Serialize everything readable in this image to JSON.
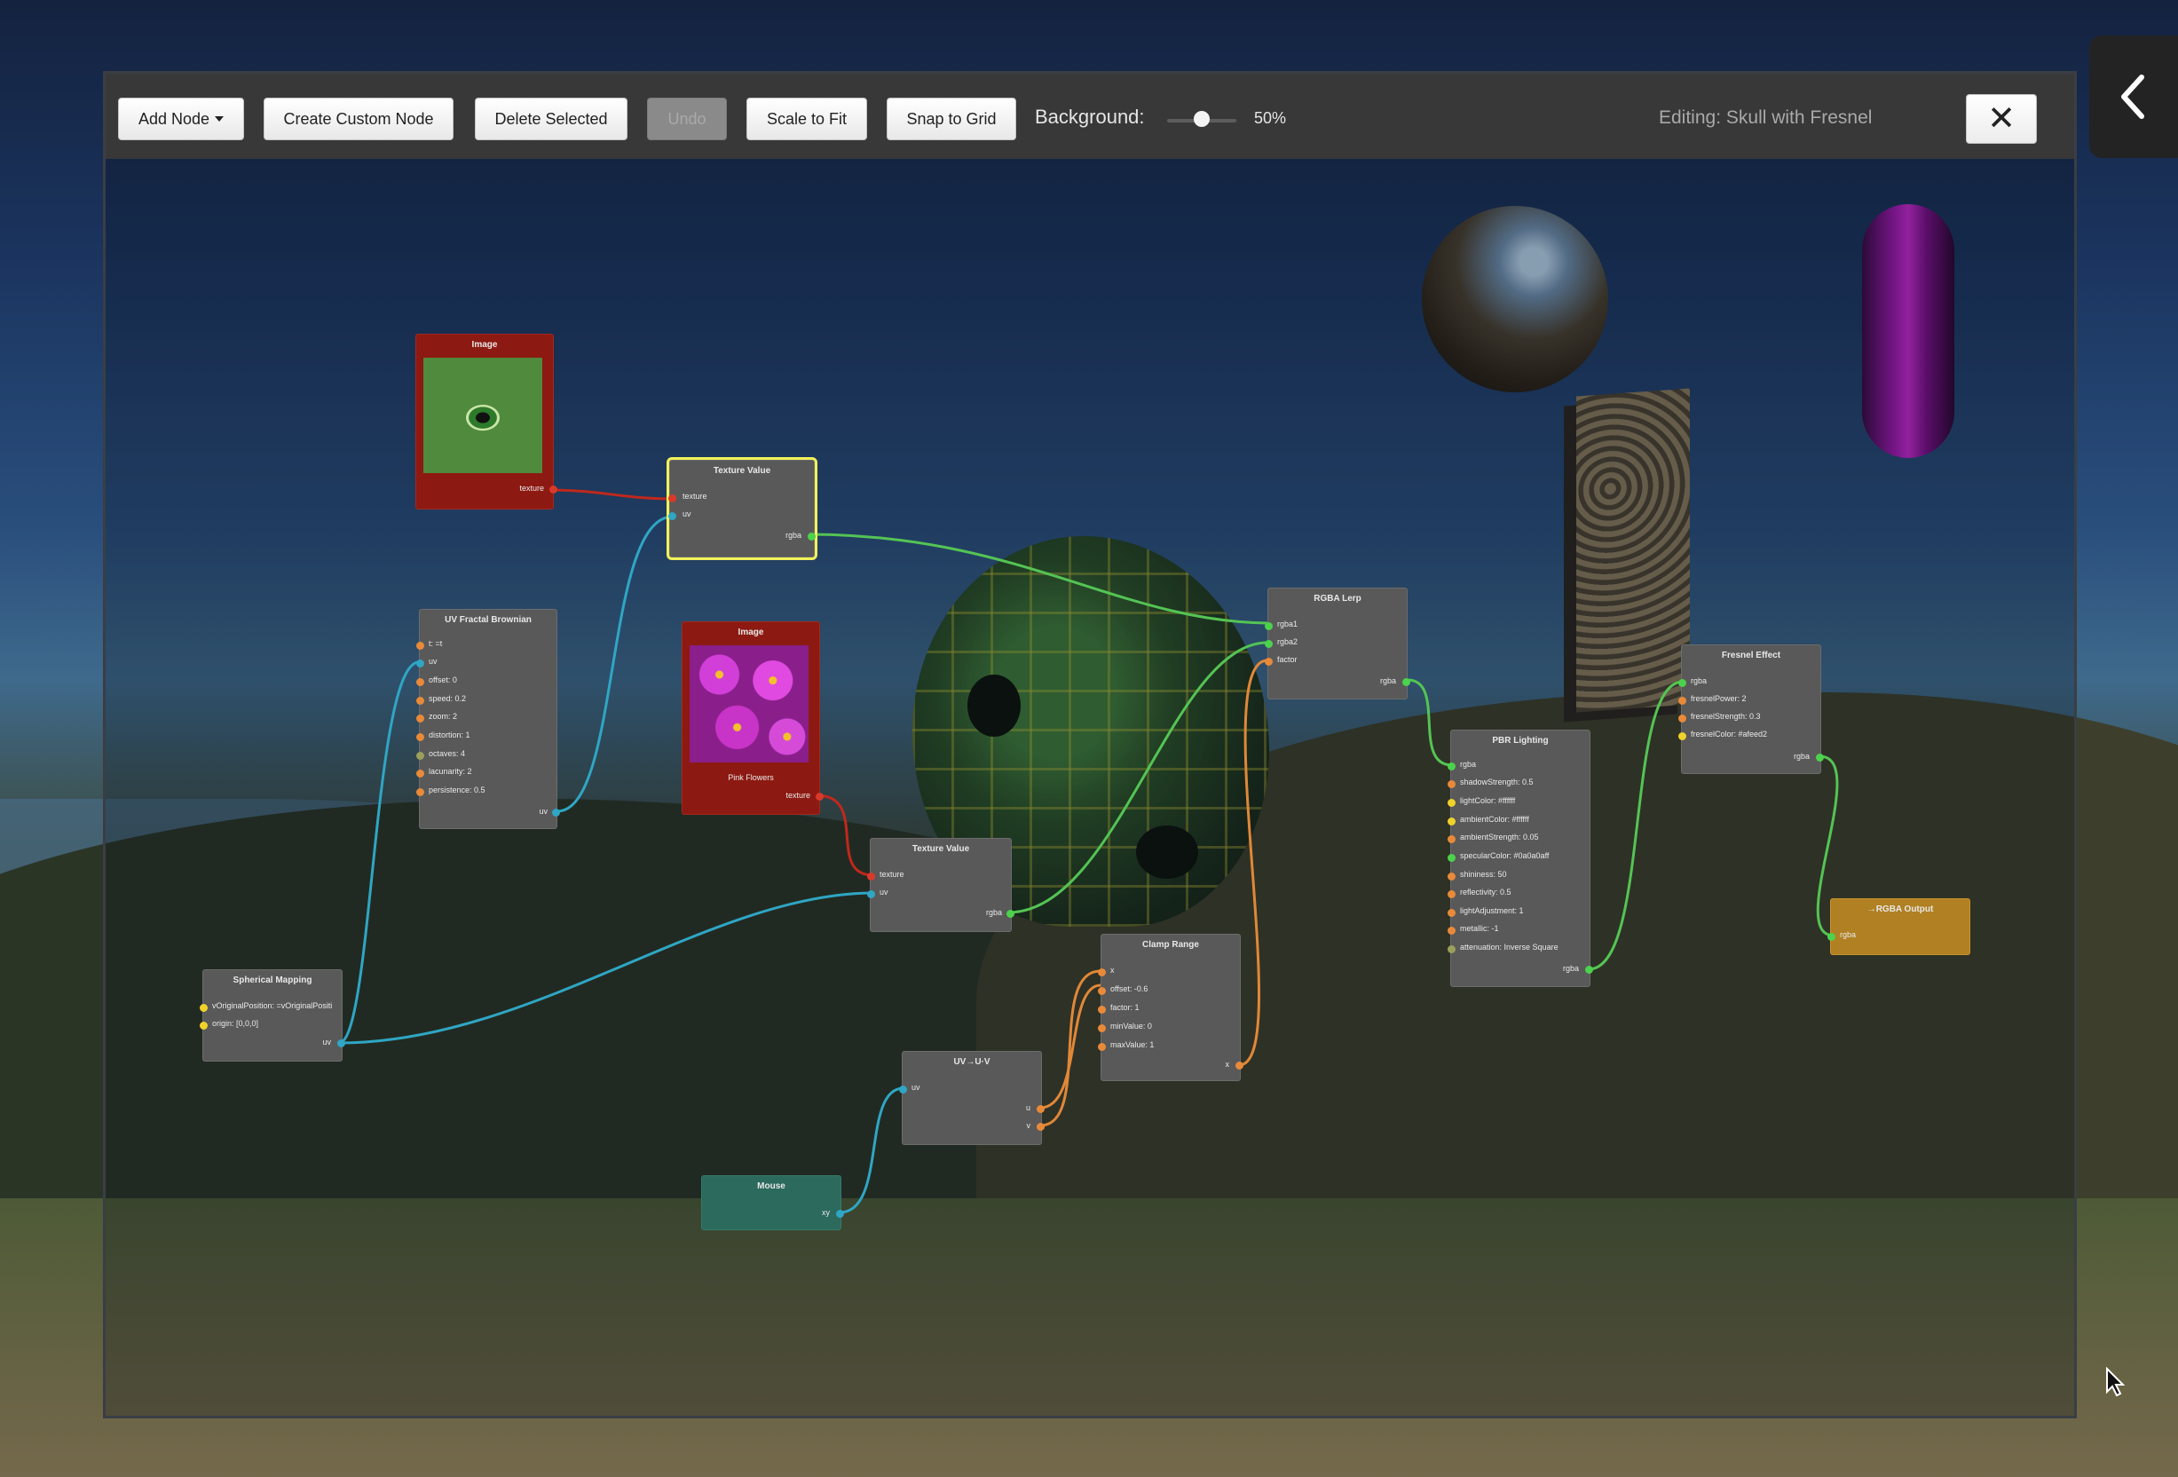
{
  "toolbar": {
    "add_node": "Add Node",
    "create_custom_node": "Create Custom Node",
    "delete_selected": "Delete Selected",
    "undo": "Undo",
    "scale_to_fit": "Scale to Fit",
    "snap_to_grid": "Snap to Grid",
    "background_label": "Background:",
    "background_value": "50%",
    "background_level": 0.5,
    "editing_label": "Editing: Skull with Fresnel",
    "close": "✕"
  },
  "nodes": {
    "image_eye": {
      "title": "Image",
      "out_texture": "texture"
    },
    "texture_value_1": {
      "title": "Texture Value",
      "in_texture": "texture",
      "in_uv": "uv",
      "out_rgba": "rgba"
    },
    "uv_fractal": {
      "title": "UV Fractal Brownian",
      "inputs": [
        "t: =t",
        "uv",
        "offset: 0",
        "speed: 0.2",
        "zoom: 2",
        "distortion: 1",
        "octaves: 4",
        "lacunarity: 2",
        "persistence: 0.5"
      ],
      "out_uv": "uv"
    },
    "image_flowers": {
      "title": "Image",
      "caption": "Pink Flowers",
      "out_texture": "texture"
    },
    "texture_value_2": {
      "title": "Texture Value",
      "in_texture": "texture",
      "in_uv": "uv",
      "out_rgba": "rgba"
    },
    "rgba_lerp": {
      "title": "RGBA Lerp",
      "inputs": [
        "rgba1",
        "rgba2",
        "factor"
      ],
      "out_rgba": "rgba"
    },
    "pbr_lighting": {
      "title": "PBR Lighting",
      "inputs": [
        "rgba",
        "shadowStrength: 0.5",
        "lightColor: #ffffff",
        "ambientColor: #ffffff",
        "ambientStrength: 0.05",
        "specularColor: #0a0a0aff",
        "shininess: 50",
        "reflectivity: 0.5",
        "lightAdjustment: 1",
        "metallic: -1",
        "attenuation: Inverse Square"
      ],
      "out_rgba": "rgba"
    },
    "fresnel": {
      "title": "Fresnel Effect",
      "inputs": [
        "rgba",
        "fresnelPower: 2",
        "fresnelStrength: 0.3",
        "fresnelColor: #afeed2"
      ],
      "out_rgba": "rgba"
    },
    "rgba_output": {
      "title": "→RGBA Output",
      "in_rgba": "rgba"
    },
    "spherical_mapping": {
      "title": "Spherical Mapping",
      "inputs": [
        "vOriginalPosition: =vOriginalPositi",
        "origin: [0,0,0]"
      ],
      "out_uv": "uv"
    },
    "clamp_range": {
      "title": "Clamp Range",
      "inputs": [
        "x",
        "offset: -0.6",
        "factor: 1",
        "minValue: 0",
        "maxValue: 1"
      ],
      "out_x": "x"
    },
    "uv_split": {
      "title": "UV→U·V",
      "in_uv": "uv",
      "out_u": "u",
      "out_v": "v"
    },
    "mouse": {
      "title": "Mouse",
      "out_xy": "xy"
    }
  },
  "colors": {
    "wire_texture": "#c0281c",
    "wire_uv": "#2fa6c4",
    "wire_rgba": "#54c454",
    "wire_float": "#e08838",
    "selected_outline": "#f2f25a"
  }
}
